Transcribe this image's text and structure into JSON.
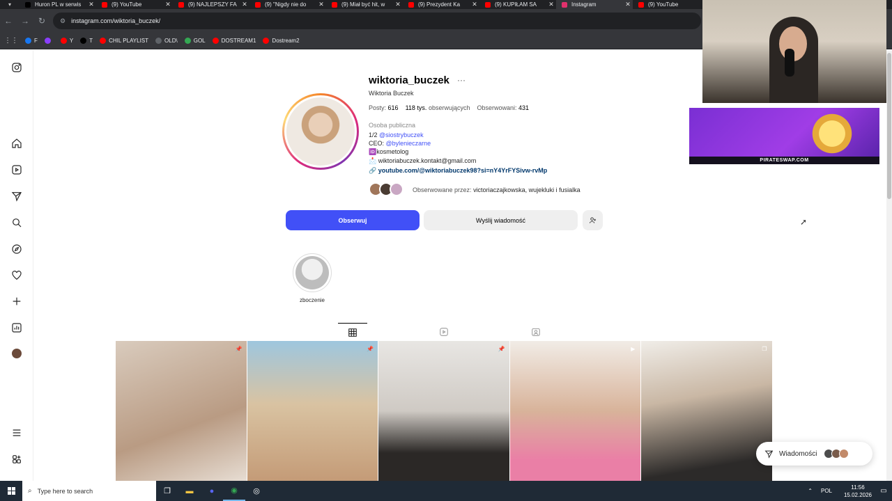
{
  "browser": {
    "tabs": [
      {
        "title": "Huron PL w serwis",
        "color": "#000000",
        "active": false
      },
      {
        "title": "(9) YouTube",
        "color": "#ff0000",
        "active": false
      },
      {
        "title": "(9) NAJLEPSZY FA",
        "color": "#ff0000",
        "active": false
      },
      {
        "title": "(9) \"Nigdy nie do",
        "color": "#ff0000",
        "active": false
      },
      {
        "title": "(9) Miał być hit, w",
        "color": "#ff0000",
        "active": false
      },
      {
        "title": "(9) Prezydent Ka",
        "color": "#ff0000",
        "active": false
      },
      {
        "title": "(9) KUPIŁAM SA",
        "color": "#ff0000",
        "active": false
      },
      {
        "title": "Instagram",
        "color": "#e1306c",
        "active": true
      },
      {
        "title": "(9) YouTube",
        "color": "#ff0000",
        "active": false
      }
    ],
    "url": "instagram.com/wiktoria_buczek/",
    "bookmarks": [
      {
        "label": "F",
        "color": "#1877f2"
      },
      {
        "label": "",
        "color": "#8a3ffc"
      },
      {
        "label": "Y",
        "color": "#ff0000"
      },
      {
        "label": "T",
        "color": "#000000"
      },
      {
        "label": "CHIL PLAYLIST",
        "color": "#ff0000"
      },
      {
        "label": "OLD\\",
        "color": "#5f6368"
      },
      {
        "label": "GOL",
        "color": "#34a853"
      },
      {
        "label": "DOSTREAM1",
        "color": "#ff0000"
      },
      {
        "label": "Dostream2",
        "color": "#ff0000"
      }
    ]
  },
  "profile": {
    "username": "wiktoria_buczek",
    "full_name": "Wiktoria Buczek",
    "posts_label": "Postу:",
    "posts_value": "616",
    "followers_value": "118 tys.",
    "followers_label": "obserwujących",
    "following_label": "Obserwowani:",
    "following_value": "431",
    "category": "Osoba publiczna",
    "bio": {
      "line1_prefix": "1/2 ",
      "line1_mention": "@siostrybuczek",
      "line2_prefix": "CEO: ",
      "line2_mention": "@bylenieczarne",
      "line3": "🆔kosmetolog",
      "line4": "📩 wiktoriabuczek.kontakt@gmail.com",
      "link": "🔗 youtube.com/@wiktoriabuczek98?si=nY4YrFYSivw-rvMp"
    },
    "followed_by_prefix": "Obserwowane przez:",
    "followed_by_names": "victoriaczajkowska, wujekluki i fusialka",
    "follow_button": "Obserwuj",
    "message_button": "Wyślij wiadomość",
    "highlight_label": "zboczenie",
    "messages_pill": "Wiadomości"
  },
  "ad": {
    "text": "PIRATESWAP.COM"
  },
  "taskbar": {
    "search_placeholder": "Type here to search",
    "language": "POL",
    "time": "11:56",
    "date": "15.02.2026"
  }
}
